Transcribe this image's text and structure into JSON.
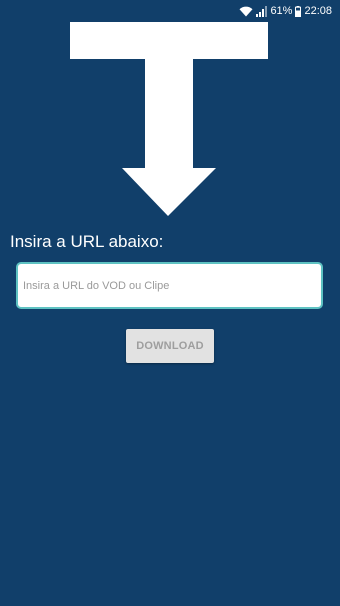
{
  "status_bar": {
    "battery_percent": "61%",
    "time": "22:08"
  },
  "main": {
    "prompt_label": "Insira a URL abaixo:",
    "url_input": {
      "value": "",
      "placeholder": "Insira a URL do VOD ou Clipe"
    },
    "download_button_label": "DOWNLOAD"
  },
  "icons": {
    "logo": "t-arrow-down-logo",
    "wifi": "wifi-icon",
    "signal": "signal-icon",
    "battery": "battery-icon"
  },
  "colors": {
    "background": "#113f6a",
    "input_border": "#5ec2c2",
    "button_background": "#e2e2e2",
    "button_text": "#9e9e9e",
    "text": "#ffffff"
  }
}
